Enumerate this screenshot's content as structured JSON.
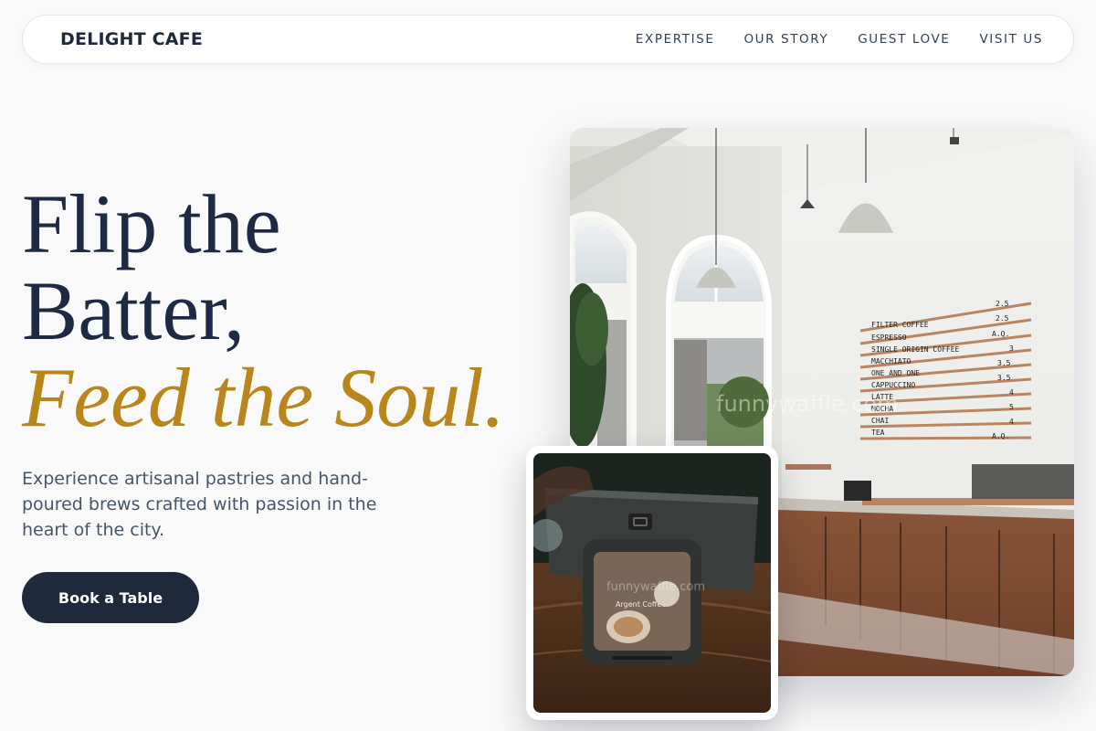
{
  "brand": "DELIGHT CAFE",
  "nav": [
    "EXPERTISE",
    "OUR STORY",
    "GUEST LOVE",
    "VISIT US"
  ],
  "hero": {
    "line1": "Flip the",
    "line2": "Batter,",
    "accent": "Feed the Soul.",
    "subtitle": "Experience artisanal pastries and hand-poured brews crafted with passion in the heart of the city.",
    "cta": "Book a Table"
  },
  "menu_board": {
    "items": [
      "FILTER COFFEE",
      "ESPRESSO",
      "SINGLE ORIGIN COFFEE",
      "MACCHIATO",
      "ONE AND ONE",
      "CAPPUCCINO",
      "LATTE",
      "MOCHA",
      "CHAI",
      "TEA"
    ],
    "prices": [
      "2.5",
      "2.5",
      "A.Q.",
      "3",
      "3.5",
      "3.5",
      "4",
      "5",
      "4",
      "A.Q."
    ]
  },
  "watermark": "funnywaffle.com",
  "tablet": {
    "screen_title": "Argent Coffee",
    "watermark": "funnywaffle.com"
  },
  "colors": {
    "navy": "#1e293b",
    "gold": "#b8861b",
    "page_bg": "#f9f9f9"
  }
}
